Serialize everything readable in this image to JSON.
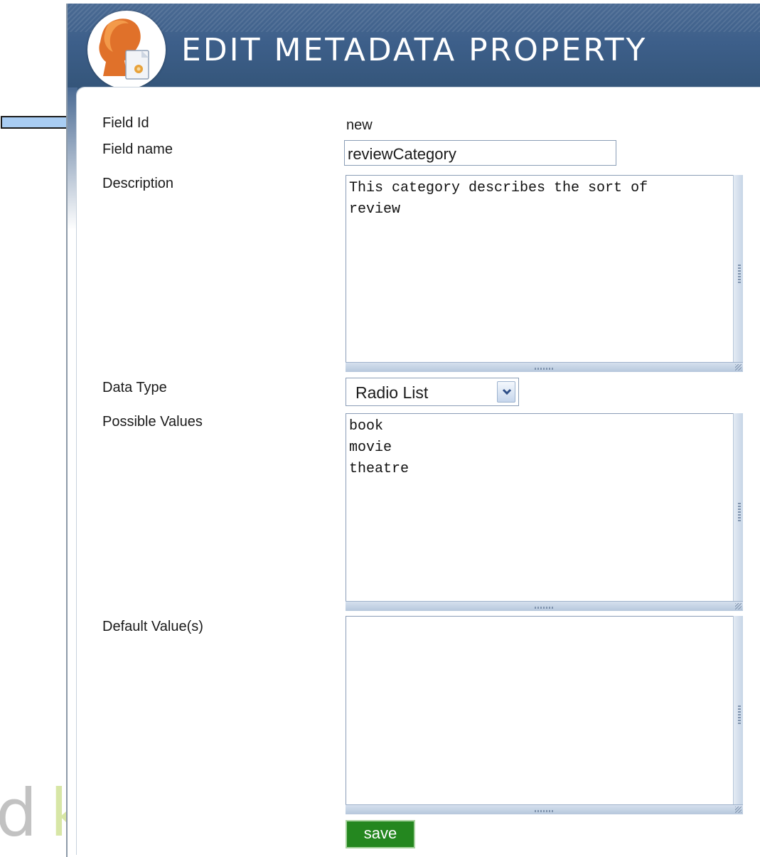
{
  "header": {
    "title": "EDIT METADATA PROPERTY"
  },
  "form": {
    "field_id": {
      "label": "Field Id",
      "value": "new"
    },
    "field_name": {
      "label": "Field name",
      "value": "reviewCategory"
    },
    "description": {
      "label": "Description",
      "value": "This category describes the sort of\nreview"
    },
    "data_type": {
      "label": "Data Type",
      "selected": "Radio List"
    },
    "possible_values": {
      "label": "Possible Values",
      "value": "book\nmovie\ntheatre"
    },
    "default_values": {
      "label": "Default Value(s)",
      "value": ""
    },
    "save_label": "save"
  },
  "background": {
    "watermark_text": "d",
    "watermark_text_2": "k"
  },
  "colors": {
    "header": "#3d5f8a",
    "save_button": "#24871f",
    "arrow_fill": "#a9cdf3"
  }
}
